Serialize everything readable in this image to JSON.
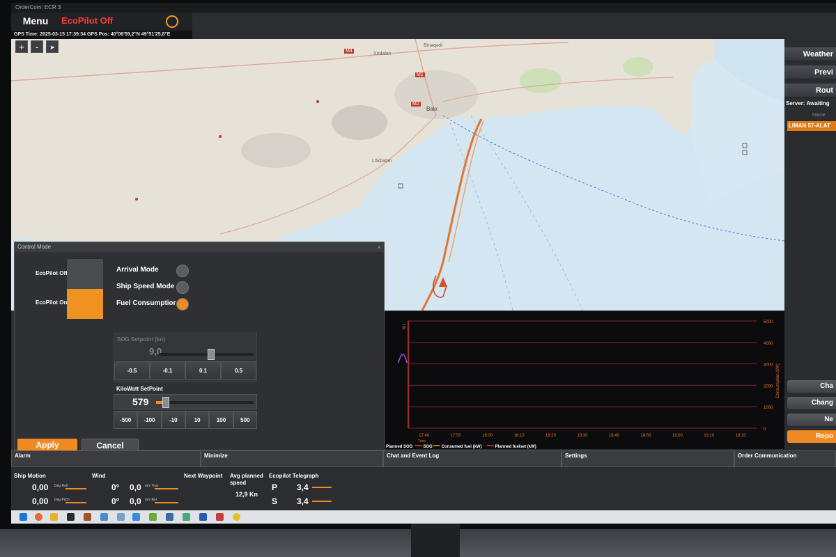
{
  "app": {
    "window_title": "OrderCom: ECR 3",
    "menu_label": "Menu",
    "ecopilot_status": "EcoPilot Off",
    "gps_time_label": "GPS Time:",
    "gps_time": "2025-03-15 17:39:34",
    "gps_pos_label": "GPS Pos:",
    "gps_pos": "40°06'59,2\"N 49°51'25,8\"E"
  },
  "map": {
    "zoom_in": "+",
    "zoom_out": "-",
    "labels": {
      "xirdalan": "Xirdalan",
      "baki": "Bakı",
      "lokbatan": "Lökbatan",
      "binagadi": "Binəqədi",
      "m4": "M4",
      "m1": "M1",
      "m2": "M2"
    }
  },
  "right_panel": {
    "weather": "Weather",
    "preview": "Previ",
    "route": "Rout",
    "server": "Server: Awaiting",
    "name_header": "Name",
    "route_item": "LIMAN 57-ALAT",
    "btn1": "Cha",
    "btn2": "Chang",
    "btn3": "Ne",
    "btn4": "Repo"
  },
  "control_mode": {
    "title": "Control Mode",
    "close": "×",
    "ecopilot_off": "EcoPilot Off",
    "ecopilot_on": "EcoPilot On",
    "arrival_mode": "Arrival Mode",
    "ship_speed_mode": "Ship Speed Mode",
    "fuel_consumption": "Fuel Consumptior",
    "selected_mode": "fuel",
    "sog_header": "SOG Setpoint (kn)",
    "sog_value": "9,0",
    "sog_level": 0.55,
    "sog_steps": [
      "-0.5",
      "-0.1",
      "0.1",
      "0.5"
    ],
    "kw_header": "KiloWatt SetPoint",
    "kw_value": "579",
    "kw_level": 0.1,
    "kw_steps": [
      "-500",
      "-100",
      "-10",
      "10",
      "100",
      "500"
    ],
    "apply": "Apply Changes",
    "cancel": "Cancel"
  },
  "chart_data": {
    "type": "line",
    "title": "",
    "xlabel": "Time",
    "ylabel_left": "Kn",
    "ylabel_right": "Consumption (kW)",
    "categories": [
      "17:40",
      "17:50",
      "18:00",
      "18:10",
      "18:20",
      "18:30",
      "18:40",
      "18:50",
      "19:00",
      "19:10",
      "19:20"
    ],
    "right_ticks": [
      0,
      1000,
      2000,
      3000,
      4000,
      5000
    ],
    "ylim_right": [
      0,
      5000
    ],
    "legend": [
      "Planned SOG",
      "SOG",
      "Consumed fuel (kW)",
      "Planned fuelset (kW)"
    ],
    "series": [
      {
        "name": "Planned SOG",
        "color": "#b04cff",
        "values": [
          null
        ]
      }
    ]
  },
  "tabs": {
    "alarm": "Alarm",
    "minimize": "Minimize",
    "chat": "Chat and Event Log",
    "settings": "Settings",
    "order": "Order Communication"
  },
  "status": {
    "ship_motion": "Ship Motion",
    "roll_val": "0,00",
    "roll_unit": "Deg Roll",
    "pitch_val": "0,00",
    "pitch_unit": "Deg Pitch",
    "wind": "Wind",
    "wind_dir1": "0°",
    "wind_speed1": "0,0",
    "wind_unit1": "m/s True",
    "wind_dir2": "0°",
    "wind_speed2": "0,0",
    "wind_unit2": "m/s Rel",
    "next_waypoint": "Next Waypoint",
    "avg_speed_label": "Avg planned speed",
    "avg_speed": "12,9 Kn",
    "telegraph": "Ecopilot Telegraph",
    "p_label": "P",
    "p_val": "3,4",
    "s_label": "S",
    "s_val": "3,4"
  },
  "colors": {
    "accent": "#f08a24",
    "status_off": "#ff3b2f",
    "track": "#e8722a"
  }
}
